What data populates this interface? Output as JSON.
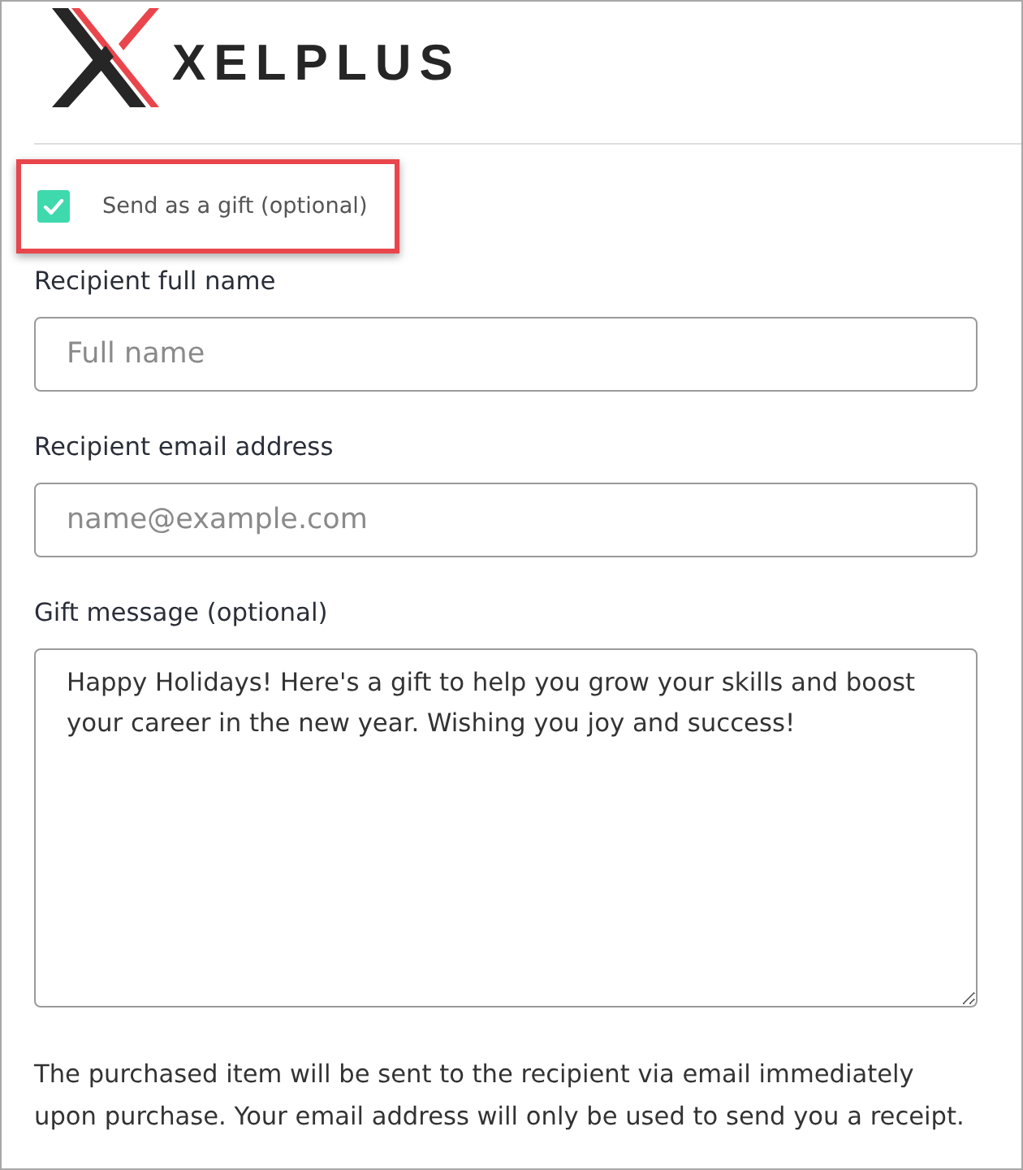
{
  "logo": {
    "text": "XELPLUS"
  },
  "gift_option": {
    "label": "Send as a gift (optional)",
    "checked": true,
    "highlighted": true
  },
  "fields": [
    {
      "kind": "input",
      "label": "Recipient full name",
      "placeholder": "Full name"
    },
    {
      "kind": "input",
      "label": "Recipient email address",
      "placeholder": "name@example.com"
    },
    {
      "kind": "textarea",
      "label": "Gift message (optional)",
      "value": "Happy Holidays! Here's a gift to help you grow your skills and boost your career in the new year. Wishing you joy and success!"
    }
  ],
  "note": "The purchased item will be sent to the recipient via email immediately upon purchase. Your email address will only be used to send you a receipt."
}
